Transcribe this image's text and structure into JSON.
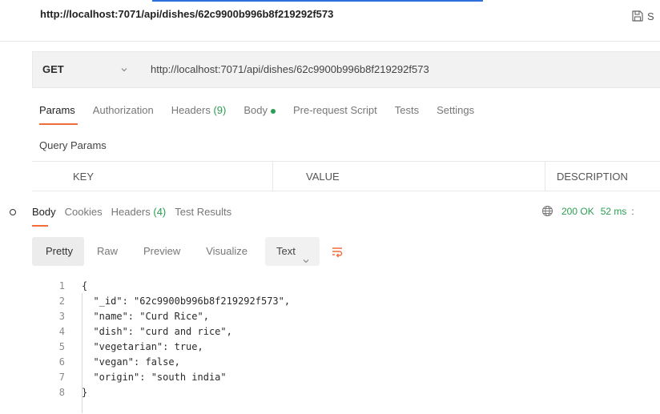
{
  "title": {
    "url": "http://localhost:7071/api/dishes/62c9900b996b8f219292f573",
    "save_label": "S"
  },
  "request": {
    "method": "GET",
    "url": "http://localhost:7071/api/dishes/62c9900b996b8f219292f573"
  },
  "request_tabs": [
    {
      "label": "Params",
      "active": true
    },
    {
      "label": "Authorization"
    },
    {
      "label": "Headers",
      "count": "(9)"
    },
    {
      "label": "Body",
      "indicator": "green-dot"
    },
    {
      "label": "Pre-request Script"
    },
    {
      "label": "Tests"
    },
    {
      "label": "Settings"
    }
  ],
  "query_params": {
    "label": "Query Params",
    "columns": [
      "KEY",
      "VALUE",
      "DESCRIPTION"
    ]
  },
  "response": {
    "tabs": [
      {
        "label": "Body",
        "active": true
      },
      {
        "label": "Cookies"
      },
      {
        "label": "Headers",
        "count": "(4)"
      },
      {
        "label": "Test Results"
      }
    ],
    "status": "200 OK",
    "time": "52 ms",
    "more": ":",
    "view_modes": [
      "Pretty",
      "Raw",
      "Preview",
      "Visualize"
    ],
    "format": "Text",
    "code_lines": [
      {
        "n": "1",
        "text": "{"
      },
      {
        "n": "2",
        "text": "  \"_id\": \"62c9900b996b8f219292f573\","
      },
      {
        "n": "3",
        "text": "  \"name\": \"Curd Rice\","
      },
      {
        "n": "4",
        "text": "  \"dish\": \"curd and rice\","
      },
      {
        "n": "5",
        "text": "  \"vegetarian\": true,"
      },
      {
        "n": "6",
        "text": "  \"vegan\": false,"
      },
      {
        "n": "7",
        "text": "  \"origin\": \"south india\""
      },
      {
        "n": "8",
        "text": "}"
      }
    ]
  },
  "colors": {
    "accent": "#f26b3a",
    "success": "#2a9e50",
    "link_underline": "#2d6fdb"
  },
  "icons": [
    "save-icon",
    "chevron-down-icon",
    "globe-icon",
    "wrap-lines-icon"
  ]
}
